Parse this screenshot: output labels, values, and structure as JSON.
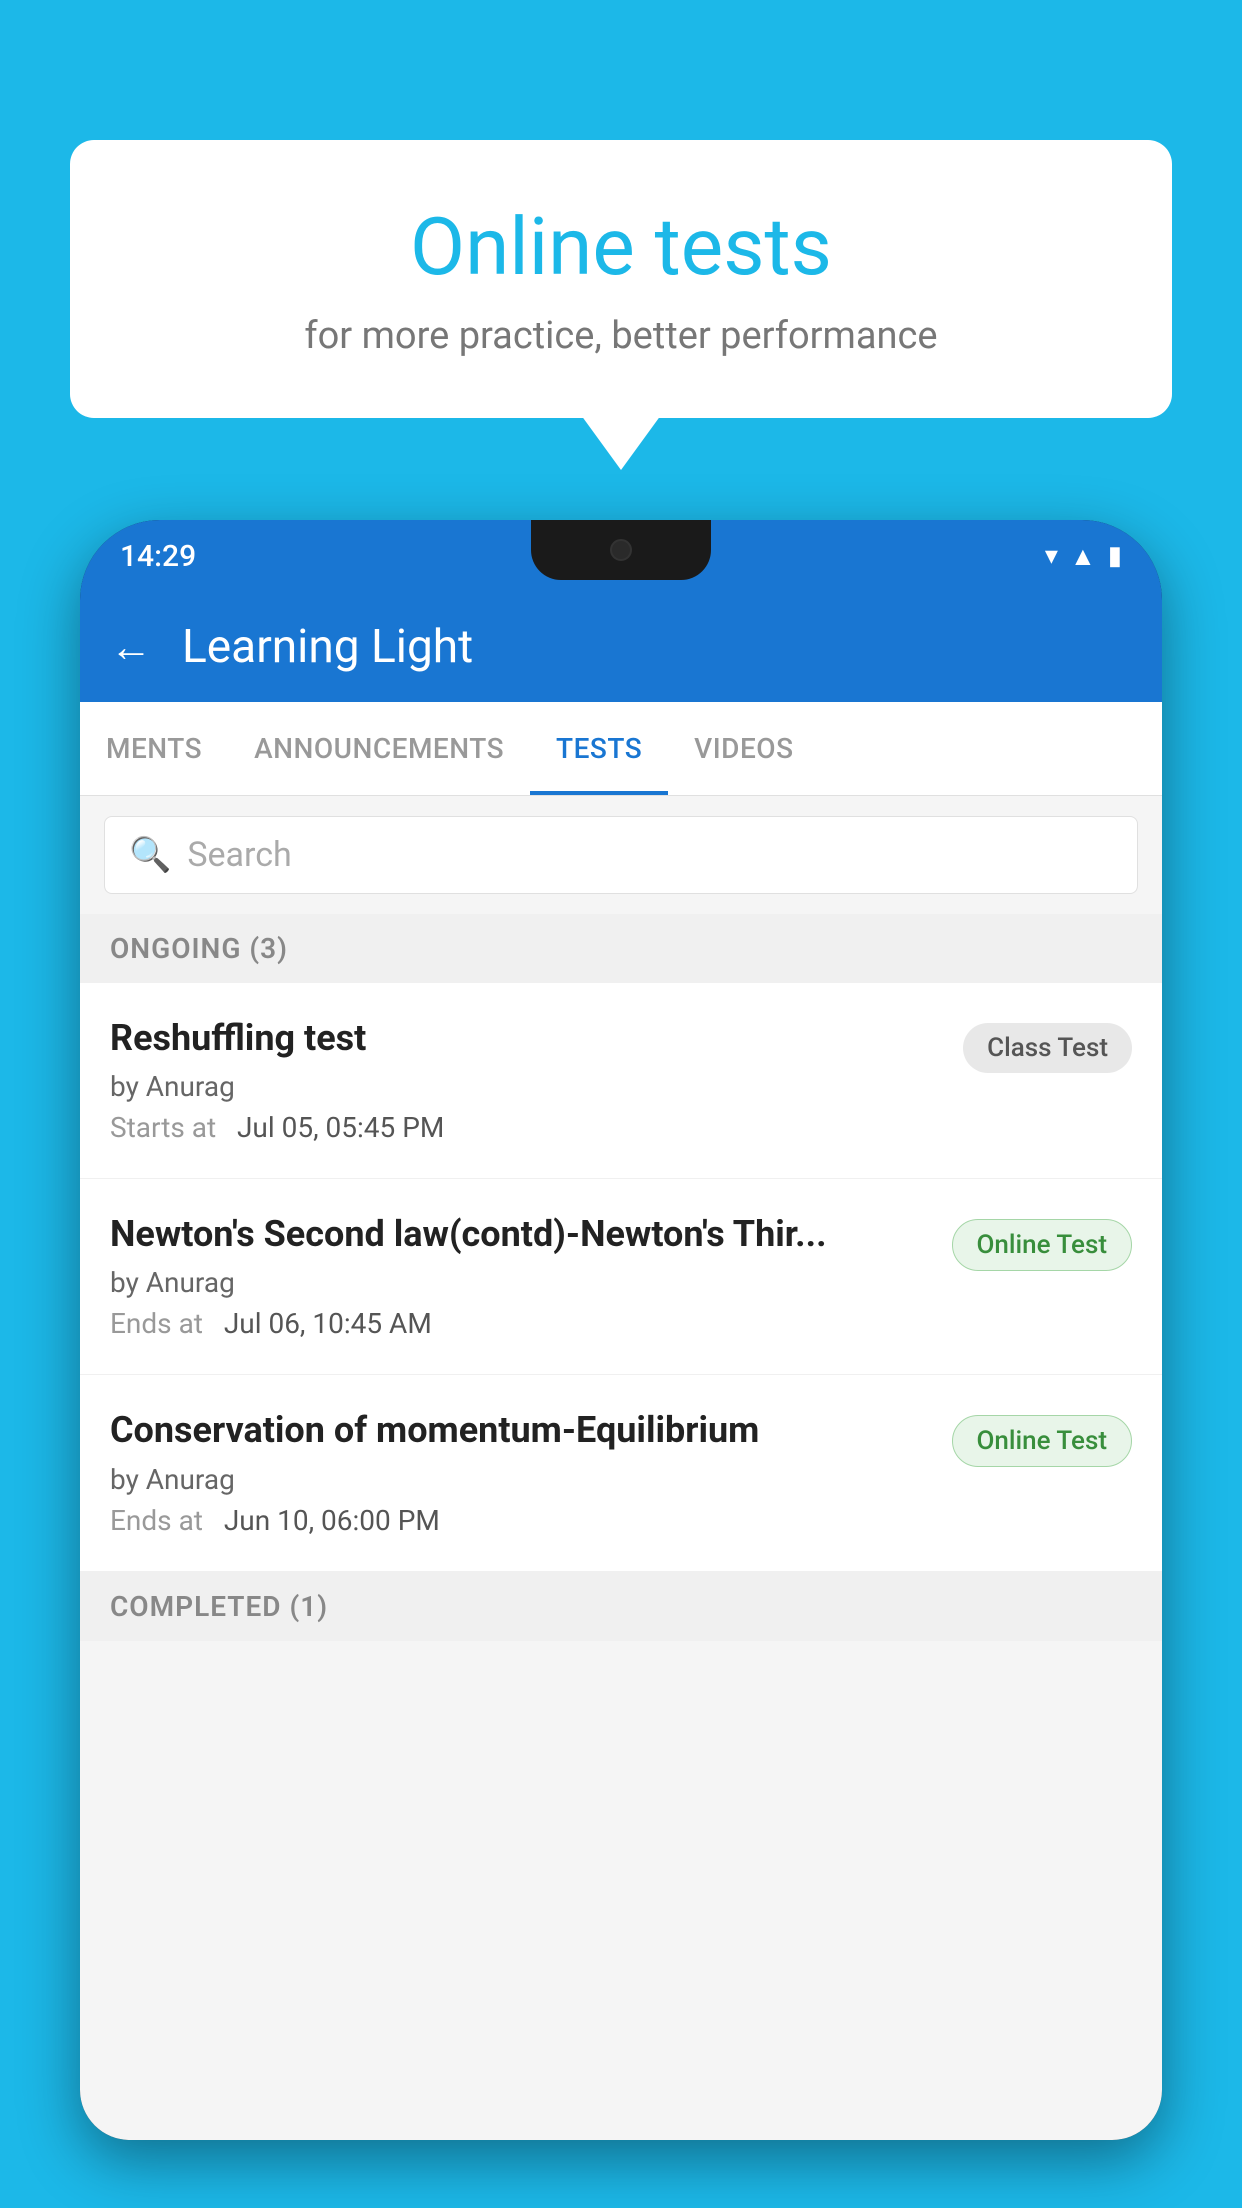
{
  "background_color": "#1cb8e8",
  "bubble": {
    "title": "Online tests",
    "subtitle": "for more practice, better performance"
  },
  "phone": {
    "status_bar": {
      "time": "14:29",
      "icons": [
        "wifi",
        "signal",
        "battery"
      ]
    },
    "app_bar": {
      "title": "Learning Light",
      "back_label": "←"
    },
    "tabs": [
      {
        "label": "MENTS",
        "active": false
      },
      {
        "label": "ANNOUNCEMENTS",
        "active": false
      },
      {
        "label": "TESTS",
        "active": true
      },
      {
        "label": "VIDEOS",
        "active": false
      }
    ],
    "search": {
      "placeholder": "Search"
    },
    "section_ongoing": {
      "label": "ONGOING (3)"
    },
    "tests": [
      {
        "name": "Reshuffling test",
        "author": "by Anurag",
        "time_label": "Starts at",
        "time_value": "Jul 05, 05:45 PM",
        "badge": "Class Test",
        "badge_type": "class"
      },
      {
        "name": "Newton's Second law(contd)-Newton's Thir...",
        "author": "by Anurag",
        "time_label": "Ends at",
        "time_value": "Jul 06, 10:45 AM",
        "badge": "Online Test",
        "badge_type": "online"
      },
      {
        "name": "Conservation of momentum-Equilibrium",
        "author": "by Anurag",
        "time_label": "Ends at",
        "time_value": "Jun 10, 06:00 PM",
        "badge": "Online Test",
        "badge_type": "online"
      }
    ],
    "section_completed": {
      "label": "COMPLETED (1)"
    }
  }
}
